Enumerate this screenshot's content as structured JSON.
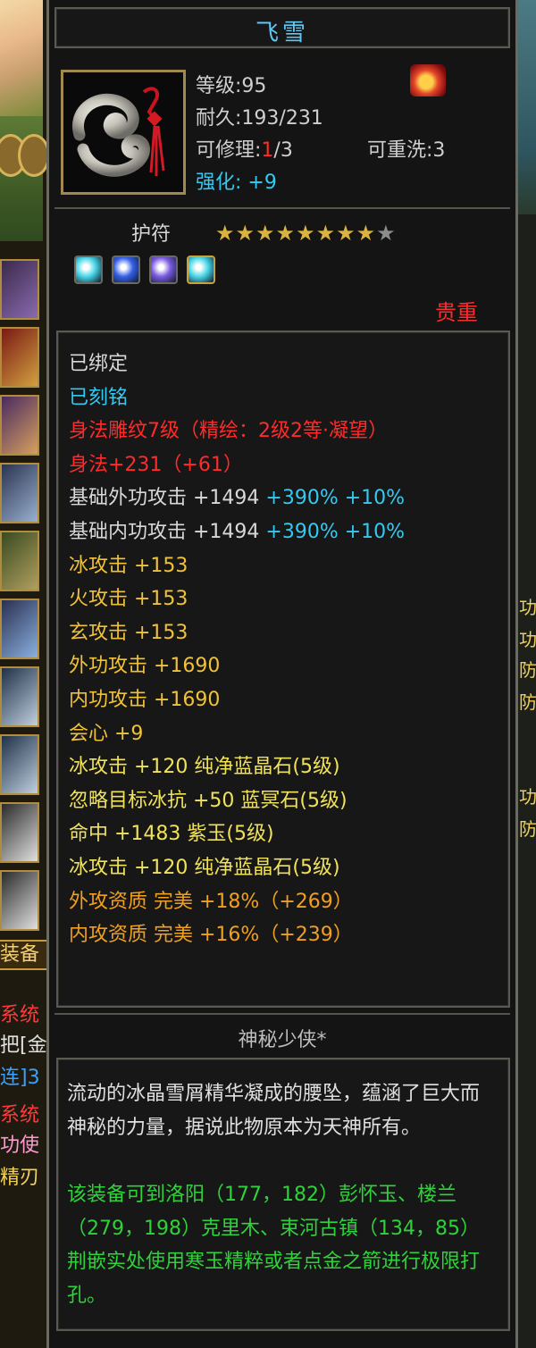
{
  "item": {
    "name": "飞雪",
    "level_line": "等级:95",
    "durability_line": "耐久:193/231",
    "repair_label": "可修理:",
    "repair_current": "1",
    "repair_max": "/3",
    "rewash_line": "可重洗:3",
    "enhance_label": "强化:",
    "enhance_value": "+9",
    "category": "护符",
    "stars_total": 9,
    "stars_filled": 8,
    "quality": "贵重"
  },
  "attributes": [
    {
      "text": "已绑定",
      "color": "#d8d8d8"
    },
    {
      "text": "已刻铭",
      "color": "#34c9f2"
    },
    {
      "text": "身法雕纹7级（精绘：2级2等·凝望）",
      "color": "#ff2a2a"
    },
    {
      "text": "身法+231（+61）",
      "color": "#ff2a2a"
    },
    {
      "text": "基础外功攻击 +1494",
      "color": "#d8d8d8",
      "extra": " +390% +10%",
      "extra_color": "#34c9f2"
    },
    {
      "text": "基础内功攻击 +1494",
      "color": "#d8d8d8",
      "extra": " +390% +10%",
      "extra_color": "#34c9f2"
    },
    {
      "text": "冰攻击 +153",
      "color": "#f0c23a"
    },
    {
      "text": "火攻击 +153",
      "color": "#f0c23a"
    },
    {
      "text": "玄攻击 +153",
      "color": "#f0c23a"
    },
    {
      "text": "外功攻击 +1690",
      "color": "#f0c23a"
    },
    {
      "text": "内功攻击 +1690",
      "color": "#f0c23a"
    },
    {
      "text": "会心 +9",
      "color": "#f0c23a"
    },
    {
      "text": "冰攻击 +120 纯净蓝晶石(5级)",
      "color": "#f0e25a"
    },
    {
      "text": "忽略目标冰抗 +50 蓝冥石(5级)",
      "color": "#f0e25a"
    },
    {
      "text": "命中 +1483 紫玉(5级)",
      "color": "#f0e25a"
    },
    {
      "text": "冰攻击 +120 纯净蓝晶石(5级)",
      "color": "#f0e25a"
    },
    {
      "text": "外攻资质  完美 +18%（+269）",
      "color": "#f0a020"
    },
    {
      "text": "内攻资质  完美 +16%（+239）",
      "color": "#f0a020"
    }
  ],
  "description": {
    "title": "神秘少侠*",
    "lore": "流动的冰晶雪屑精华凝成的腰坠，蕴涵了巨大而神秘的力量，据说此物原本为天神所有。",
    "hint": "该装备可到洛阳（177，182）彭怀玉、楼兰（279，198）克里木、束河古镇（134，85）荆嵌实处使用寒玉精粹或者点金之箭进行极限打孔。",
    "lore_color": "#e0e0e0",
    "hint_color": "#2fd23a"
  },
  "gems": [
    {
      "name": "blue-crystal-gem-icon",
      "color": "#48d6e8"
    },
    {
      "name": "blue-sapphire-gem-icon",
      "color": "#3560e8"
    },
    {
      "name": "purple-jade-gem-icon",
      "color": "#7a5ae0"
    },
    {
      "name": "blue-crystal-gem-icon",
      "color": "#48d6e8"
    }
  ],
  "background": {
    "equip_tab": "装备",
    "left_fragments": [
      "系统",
      "把[金",
      "连]3",
      "系统",
      "功使",
      "精刃"
    ],
    "right_fragments": [
      "功",
      "功",
      "防",
      "防",
      "功",
      "防"
    ]
  }
}
